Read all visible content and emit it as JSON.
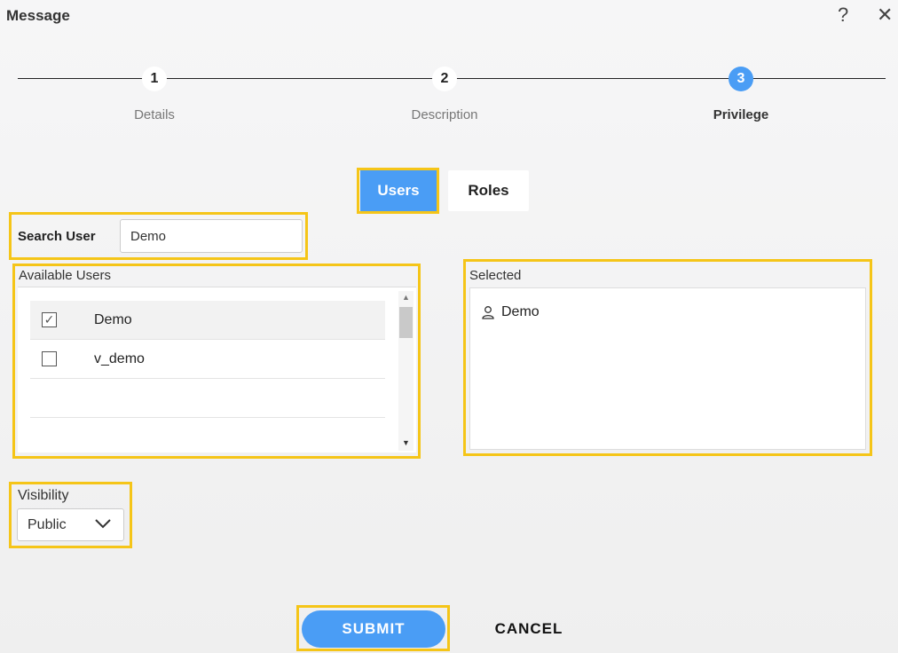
{
  "window": {
    "title": "Message",
    "help": "?",
    "close": "✕"
  },
  "steps": [
    {
      "number": "1",
      "label": "Details"
    },
    {
      "number": "2",
      "label": "Description"
    },
    {
      "number": "3",
      "label": "Privilege"
    }
  ],
  "tabs": {
    "users": "Users",
    "roles": "Roles"
  },
  "search": {
    "label": "Search User",
    "value": "Demo"
  },
  "available": {
    "label": "Available Users",
    "users": [
      {
        "name": "Demo",
        "checked": true
      },
      {
        "name": "v_demo",
        "checked": false
      }
    ]
  },
  "selected": {
    "label": "Selected",
    "items": [
      "Demo"
    ]
  },
  "visibility": {
    "label": "Visibility",
    "value": "Public"
  },
  "actions": {
    "submit": "SUBMIT",
    "cancel": "CANCEL"
  },
  "colors": {
    "accent": "#4a9df5",
    "highlight": "#f5c518"
  }
}
